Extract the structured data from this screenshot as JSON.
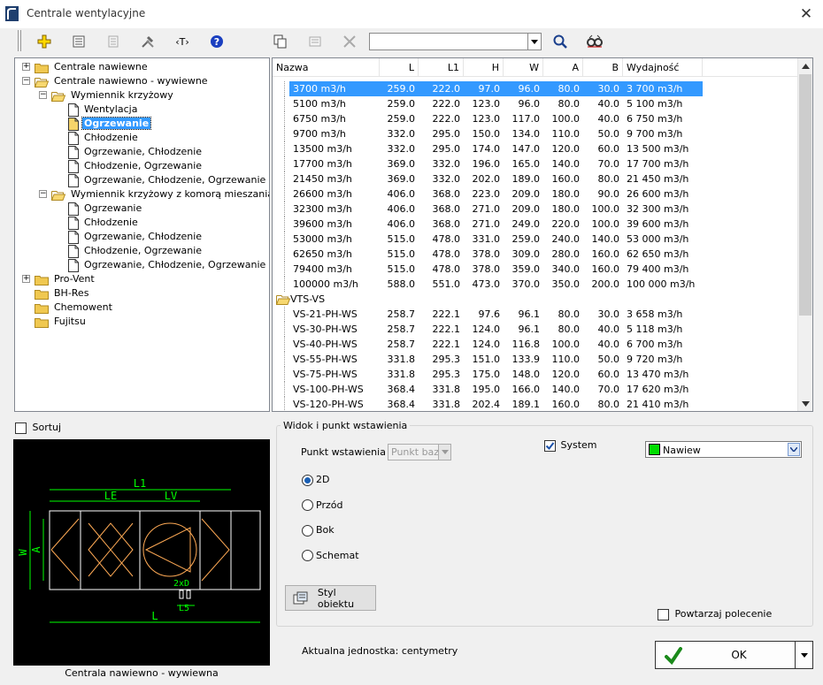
{
  "window": {
    "title": "Centrale wentylacyjne",
    "close_glyph": "✕"
  },
  "toolbar": {
    "search_value": "",
    "icons": [
      "add-icon",
      "properties-icon",
      "list-icon",
      "tools-icon",
      "text-icon",
      "help-icon",
      "copy-icon",
      "paste-icon",
      "delete-icon",
      "search-icon",
      "find-icon"
    ]
  },
  "tree": {
    "expand_glyph": "+",
    "collapse_glyph": "−",
    "nodes": [
      {
        "label": "Centrale nawiewne"
      },
      {
        "label": "Centrale nawiewno - wywiewne"
      },
      {
        "label": "Wymiennik krzyżowy"
      },
      {
        "label": "Wentylacja"
      },
      {
        "label": "Ogrzewanie"
      },
      {
        "label": "Chłodzenie"
      },
      {
        "label": "Ogrzewanie, Chłodzenie"
      },
      {
        "label": "Chłodzenie, Ogrzewanie"
      },
      {
        "label": "Ogrzewanie, Chłodzenie, Ogrzewanie"
      },
      {
        "label": "Wymiennik krzyżowy z komorą mieszania"
      },
      {
        "label": "Ogrzewanie"
      },
      {
        "label": "Chłodzenie"
      },
      {
        "label": "Ogrzewanie, Chłodzenie"
      },
      {
        "label": "Chłodzenie, Ogrzewanie"
      },
      {
        "label": "Ogrzewanie, Chłodzenie, Ogrzewanie"
      },
      {
        "label": "Pro-Vent"
      },
      {
        "label": "BH-Res"
      },
      {
        "label": "Chemowent"
      },
      {
        "label": "Fujitsu"
      }
    ]
  },
  "grid": {
    "columns": [
      "Nazwa",
      "L",
      "L1",
      "H",
      "W",
      "A",
      "B",
      "Wydajność"
    ],
    "rows": [
      {
        "name": "3700 m3/h",
        "cells": [
          "259.0",
          "222.0",
          "97.0",
          "96.0",
          "80.0",
          "30.0",
          "3 700 m3/h"
        ]
      },
      {
        "name": "5100 m3/h",
        "cells": [
          "259.0",
          "222.0",
          "123.0",
          "96.0",
          "80.0",
          "40.0",
          "5 100 m3/h"
        ]
      },
      {
        "name": "6750 m3/h",
        "cells": [
          "259.0",
          "222.0",
          "123.0",
          "117.0",
          "100.0",
          "40.0",
          "6 750 m3/h"
        ]
      },
      {
        "name": "9700 m3/h",
        "cells": [
          "332.0",
          "295.0",
          "150.0",
          "134.0",
          "110.0",
          "50.0",
          "9 700 m3/h"
        ]
      },
      {
        "name": "13500 m3/h",
        "cells": [
          "332.0",
          "295.0",
          "174.0",
          "147.0",
          "120.0",
          "60.0",
          "13 500 m3/h"
        ]
      },
      {
        "name": "17700 m3/h",
        "cells": [
          "369.0",
          "332.0",
          "196.0",
          "165.0",
          "140.0",
          "70.0",
          "17 700 m3/h"
        ]
      },
      {
        "name": "21450 m3/h",
        "cells": [
          "369.0",
          "332.0",
          "202.0",
          "189.0",
          "160.0",
          "80.0",
          "21 450 m3/h"
        ]
      },
      {
        "name": "26600 m3/h",
        "cells": [
          "406.0",
          "368.0",
          "223.0",
          "209.0",
          "180.0",
          "90.0",
          "26 600 m3/h"
        ]
      },
      {
        "name": "32300 m3/h",
        "cells": [
          "406.0",
          "368.0",
          "271.0",
          "209.0",
          "180.0",
          "100.0",
          "32 300 m3/h"
        ]
      },
      {
        "name": "39600 m3/h",
        "cells": [
          "406.0",
          "368.0",
          "271.0",
          "249.0",
          "220.0",
          "100.0",
          "39 600 m3/h"
        ]
      },
      {
        "name": "53000 m3/h",
        "cells": [
          "515.0",
          "478.0",
          "331.0",
          "259.0",
          "240.0",
          "140.0",
          "53 000 m3/h"
        ]
      },
      {
        "name": "62650 m3/h",
        "cells": [
          "515.0",
          "478.0",
          "378.0",
          "309.0",
          "280.0",
          "160.0",
          "62 650 m3/h"
        ]
      },
      {
        "name": "79400 m3/h",
        "cells": [
          "515.0",
          "478.0",
          "378.0",
          "359.0",
          "340.0",
          "160.0",
          "79 400 m3/h"
        ]
      },
      {
        "name": "100000 m3/h",
        "cells": [
          "588.0",
          "551.0",
          "473.0",
          "370.0",
          "350.0",
          "200.0",
          "100 000 m3/h"
        ]
      },
      {
        "name": "VTS-VS",
        "group": true,
        "cells": []
      },
      {
        "name": "VS-21-PH-WS",
        "cells": [
          "258.7",
          "222.1",
          "97.6",
          "96.1",
          "80.0",
          "30.0",
          "3 658 m3/h"
        ]
      },
      {
        "name": "VS-30-PH-WS",
        "cells": [
          "258.7",
          "222.1",
          "124.0",
          "96.1",
          "80.0",
          "40.0",
          "5 118 m3/h"
        ]
      },
      {
        "name": "VS-40-PH-WS",
        "cells": [
          "258.7",
          "222.1",
          "124.0",
          "116.8",
          "100.0",
          "40.0",
          "6 700 m3/h"
        ]
      },
      {
        "name": "VS-55-PH-WS",
        "cells": [
          "331.8",
          "295.3",
          "151.0",
          "133.9",
          "110.0",
          "50.0",
          "9 720 m3/h"
        ]
      },
      {
        "name": "VS-75-PH-WS",
        "cells": [
          "331.8",
          "295.3",
          "175.0",
          "148.0",
          "120.0",
          "60.0",
          "13 470 m3/h"
        ]
      },
      {
        "name": "VS-100-PH-WS",
        "cells": [
          "368.4",
          "331.8",
          "195.0",
          "166.0",
          "140.0",
          "70.0",
          "17 620 m3/h"
        ]
      },
      {
        "name": "VS-120-PH-WS",
        "cells": [
          "368.4",
          "331.8",
          "202.4",
          "189.1",
          "160.0",
          "80.0",
          "21 410 m3/h"
        ]
      }
    ]
  },
  "sort": {
    "label": "Sortuj",
    "checked": false
  },
  "preview": {
    "caption": "Centrala nawiewno - wywiewna",
    "dim_labels": {
      "l1": "L1",
      "le": "LE",
      "lv": "LV",
      "l": "L",
      "w": "W",
      "a": "A",
      "d": "2xD",
      "l5": "L5"
    },
    "colors": {
      "dims": "#00ff00",
      "outline": "#ffffff",
      "parts": "#ffaa55"
    }
  },
  "view": {
    "group_title": "Widok i punkt wstawienia",
    "insert_label": "Punkt wstawienia",
    "insert_value": "Punkt bazowy",
    "system_label": "System",
    "system_checked": true,
    "layer_value": "Nawiew",
    "layer_color": "#00dd00",
    "radios": [
      {
        "label": "2D",
        "checked": true
      },
      {
        "label": "Przód",
        "checked": false
      },
      {
        "label": "Bok",
        "checked": false
      },
      {
        "label": "Schemat",
        "checked": false
      }
    ],
    "style_button": "Styl obiektu",
    "repeat_label": "Powtarzaj polecenie",
    "repeat_checked": false
  },
  "footer": {
    "unit_text": "Aktualna jednostka: centymetry",
    "ok_label": "OK"
  }
}
